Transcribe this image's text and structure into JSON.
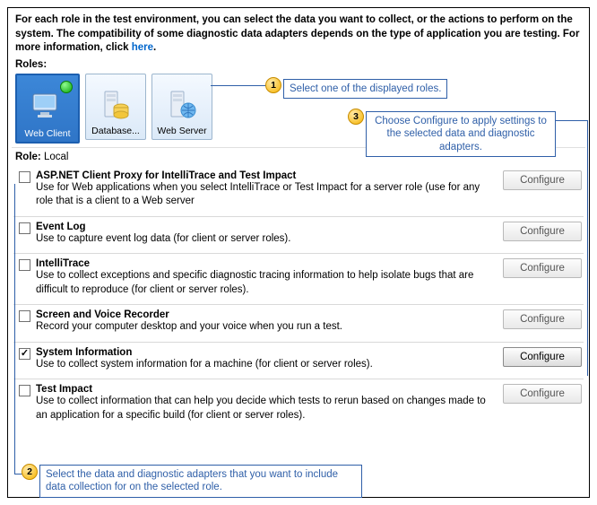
{
  "intro": {
    "text_before_link": "For each role in the test environment, you can select the data you want to collect, or the actions to perform on the system. The compatibility of some diagnostic data adapters depends on the type of application you are testing. For more information, click ",
    "link_text": "here",
    "text_after_link": "."
  },
  "labels": {
    "roles": "Roles:",
    "role_label": "Role:",
    "role_value": "Local"
  },
  "roles": [
    {
      "label": "Web Client",
      "selected": true,
      "icon": "monitor",
      "badge": true
    },
    {
      "label": "Database...",
      "selected": false,
      "icon": "db-server",
      "badge": false
    },
    {
      "label": "Web Server",
      "selected": false,
      "icon": "web-server",
      "badge": false
    }
  ],
  "configure_label": "Configure",
  "adapters": [
    {
      "title": "ASP.NET Client Proxy for IntelliTrace and Test Impact",
      "desc": "Use for Web applications when you select IntelliTrace or Test Impact for a server role (use for any role that is a client to a Web server",
      "checked": false,
      "config_enabled": false
    },
    {
      "title": "Event Log",
      "desc": "Use to capture event log data (for client or server roles).",
      "checked": false,
      "config_enabled": false
    },
    {
      "title": "IntelliTrace",
      "desc": "Use to collect exceptions and specific diagnostic tracing information to help isolate bugs that are difficult to reproduce (for client or server roles).",
      "checked": false,
      "config_enabled": false
    },
    {
      "title": "Screen and Voice Recorder",
      "desc": "Record your computer desktop and your voice when you run a test.",
      "checked": false,
      "config_enabled": false
    },
    {
      "title": "System Information",
      "desc": "Use to collect system information for a machine (for client or server roles).",
      "checked": true,
      "config_enabled": true
    },
    {
      "title": "Test Impact",
      "desc": "Use to collect information that can help you decide which tests to rerun based on changes made to an application for a specific build (for client or server roles).",
      "checked": false,
      "config_enabled": false
    }
  ],
  "callouts": {
    "c1": "Select one of the displayed roles.",
    "c2": "Select the data and diagnostic adapters that you want to include data collection for on the selected role.",
    "c3": "Choose Configure to apply settings to the selected data and diagnostic adapters."
  }
}
